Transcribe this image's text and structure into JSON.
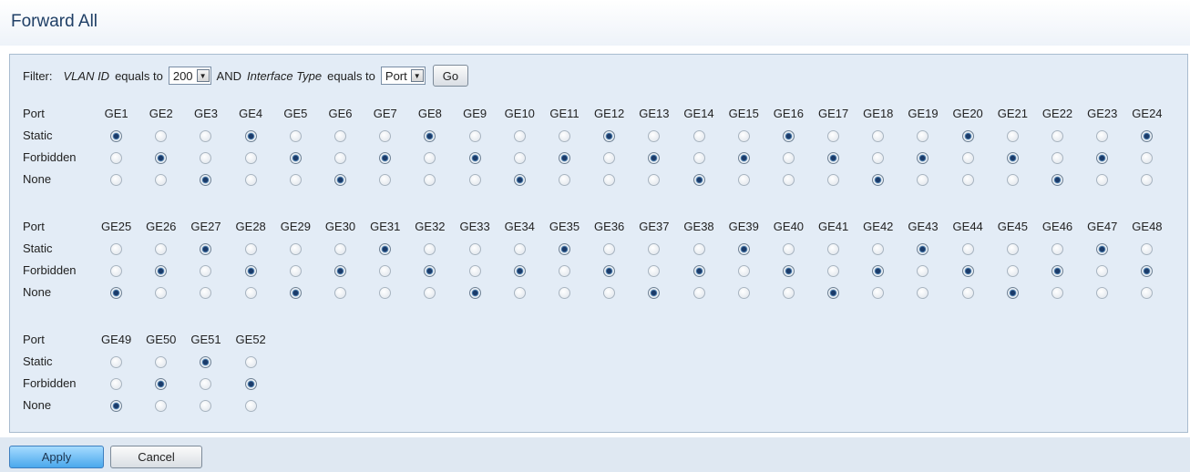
{
  "page": {
    "title": "Forward All"
  },
  "filter": {
    "label": "Filter:",
    "vlan_label": "VLAN ID",
    "equals_to_1": "equals to",
    "vlan_value": "200",
    "and": "AND",
    "iface_label": "Interface Type",
    "equals_to_2": "equals to",
    "iface_value": "Port",
    "go": "Go"
  },
  "row_labels": {
    "port": "Port",
    "static": "Static",
    "forbidden": "Forbidden",
    "none": "None"
  },
  "groups": [
    {
      "ports": [
        "GE1",
        "GE2",
        "GE3",
        "GE4",
        "GE5",
        "GE6",
        "GE7",
        "GE8",
        "GE9",
        "GE10",
        "GE11",
        "GE12",
        "GE13",
        "GE14",
        "GE15",
        "GE16",
        "GE17",
        "GE18",
        "GE19",
        "GE20",
        "GE21",
        "GE22",
        "GE23",
        "GE24"
      ],
      "selection": [
        "Static",
        "Forbidden",
        "None",
        "Static",
        "Forbidden",
        "None",
        "Forbidden",
        "Static",
        "Forbidden",
        "None",
        "Forbidden",
        "Static",
        "Forbidden",
        "None",
        "Forbidden",
        "Static",
        "Forbidden",
        "None",
        "Forbidden",
        "Static",
        "Forbidden",
        "None",
        "Forbidden",
        "Static"
      ]
    },
    {
      "ports": [
        "GE25",
        "GE26",
        "GE27",
        "GE28",
        "GE29",
        "GE30",
        "GE31",
        "GE32",
        "GE33",
        "GE34",
        "GE35",
        "GE36",
        "GE37",
        "GE38",
        "GE39",
        "GE40",
        "GE41",
        "GE42",
        "GE43",
        "GE44",
        "GE45",
        "GE46",
        "GE47",
        "GE48"
      ],
      "selection": [
        "None",
        "Forbidden",
        "Static",
        "Forbidden",
        "None",
        "Forbidden",
        "Static",
        "Forbidden",
        "None",
        "Forbidden",
        "Static",
        "Forbidden",
        "None",
        "Forbidden",
        "Static",
        "Forbidden",
        "None",
        "Forbidden",
        "Static",
        "Forbidden",
        "None",
        "Forbidden",
        "Static",
        "Forbidden"
      ]
    },
    {
      "ports": [
        "GE49",
        "GE50",
        "GE51",
        "GE52"
      ],
      "selection": [
        "None",
        "Forbidden",
        "Static",
        "Forbidden"
      ]
    }
  ],
  "buttons": {
    "apply": "Apply",
    "cancel": "Cancel"
  },
  "colors": {
    "panel_bg": "#e3ecf6",
    "title": "#1f3f66",
    "apply_bg": "#4aa8ec"
  }
}
